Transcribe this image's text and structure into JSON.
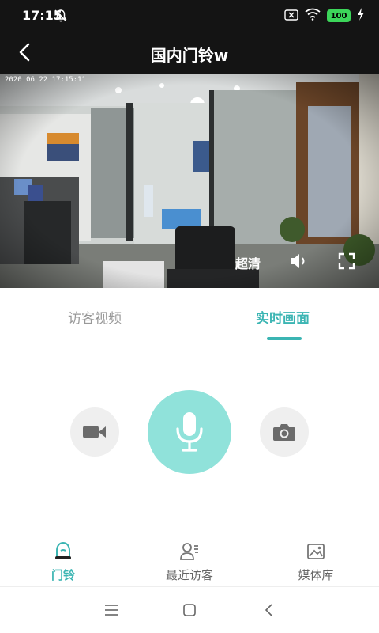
{
  "status_bar": {
    "time": "17:15",
    "battery": "100"
  },
  "header": {
    "title": "国内门铃w"
  },
  "video": {
    "timestamp": "2020 06 22 17:15:11",
    "quality_label": "超清"
  },
  "tabs": [
    {
      "label": "访客视频",
      "active": false
    },
    {
      "label": "实时画面",
      "active": true
    }
  ],
  "controls": {
    "record_icon": "video-camera-icon",
    "mic_icon": "microphone-icon",
    "snapshot_icon": "camera-icon"
  },
  "bottom_nav": [
    {
      "label": "门铃",
      "icon": "doorbell-icon",
      "active": true
    },
    {
      "label": "最近访客",
      "icon": "visitors-icon",
      "active": false
    },
    {
      "label": "媒体库",
      "icon": "gallery-icon",
      "active": false
    }
  ],
  "colors": {
    "accent": "#3bb5b3",
    "mic_bg": "#90e2da",
    "dark_bar": "#141414"
  }
}
